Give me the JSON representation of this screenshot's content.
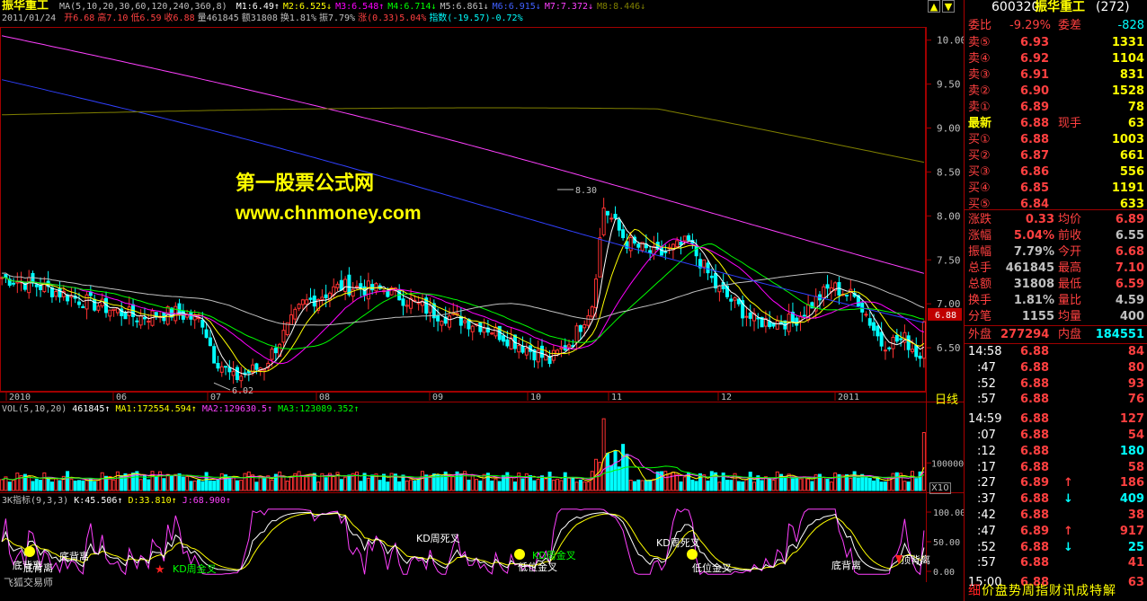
{
  "header": {
    "stock_name": "振华重工",
    "ma_line": "MA(5,10,20,30,60,120,240,360,8)",
    "ma_values": [
      {
        "label": "M1:6.49",
        "arrow": "↑",
        "color": "#ffffff"
      },
      {
        "label": "M2:6.525",
        "arrow": "↓",
        "color": "#ffff00"
      },
      {
        "label": "M3:6.548",
        "arrow": "↑",
        "color": "#ff00ff"
      },
      {
        "label": "M4:6.714",
        "arrow": "↓",
        "color": "#00ff00"
      },
      {
        "label": "M5:6.861",
        "arrow": "↓",
        "color": "#c0c0c0"
      },
      {
        "label": "M6:6.915",
        "arrow": "↓",
        "color": "#4060ff"
      },
      {
        "label": "M7:7.372",
        "arrow": "↓",
        "color": "#ff40ff"
      },
      {
        "label": "M8:8.446",
        "arrow": "↓",
        "color": "#808000"
      }
    ],
    "info_date": "2011/01/24",
    "info_items": [
      {
        "text": "开6.68",
        "color": "#ff4040"
      },
      {
        "text": "高7.10",
        "color": "#ff4040"
      },
      {
        "text": "低6.59",
        "color": "#ff4040"
      },
      {
        "text": "收6.88",
        "color": "#ff4040"
      },
      {
        "text": "量461845",
        "color": "#c0c0c0"
      },
      {
        "text": "额31808",
        "color": "#c0c0c0"
      },
      {
        "text": "换1.81%",
        "color": "#c0c0c0"
      },
      {
        "text": "振7.79%",
        "color": "#c0c0c0"
      },
      {
        "text": "涨(0.33)5.04%",
        "color": "#ff4040"
      },
      {
        "text": "指数(-19.57)-0.72%",
        "color": "#00ffff"
      }
    ]
  },
  "watermark": {
    "line1": "第一股票公式网",
    "line2": "www.chnmoney.com"
  },
  "main_chart": {
    "y_ticks": [
      "10.00",
      "9.50",
      "9.00",
      "8.50",
      "8.00",
      "7.50",
      "7.00",
      "6.50"
    ],
    "y_values": [
      10.0,
      9.5,
      9.0,
      8.5,
      8.0,
      7.5,
      7.0,
      6.5
    ],
    "x_labels": [
      "2010",
      "06",
      "07",
      "08",
      "09",
      "10",
      "11",
      "12",
      "2011"
    ],
    "x_positions": [
      0.005,
      0.12,
      0.222,
      0.34,
      0.462,
      0.568,
      0.655,
      0.774,
      0.9
    ],
    "period": "日线",
    "high_label": "8.30",
    "low_label": "6.02",
    "last_price_tag": "6.88"
  },
  "volume": {
    "title": "VOL(5,10,20)",
    "value": "461845",
    "ma1": "MA1:172554.594",
    "ma2": "MA2:129630.5",
    "ma3": "MA3:123089.352",
    "y_tick": "100000",
    "unit": "X10"
  },
  "kdj": {
    "title": "3K指标(9,3,3)",
    "k": "K:45.506",
    "d": "D:33.810",
    "j": "J:68.900",
    "y_ticks": [
      "100.00",
      "50.00",
      "0.00"
    ],
    "signals": [
      "底背离",
      "底背离",
      "KD周金叉",
      "KD周死叉",
      "KD周金叉",
      "KD周死叉",
      "低位金叉",
      "底背离",
      "顶背离",
      "低位金叉",
      "底背离"
    ],
    "footer": "飞狐交易师"
  },
  "right_panel": {
    "code": "600320",
    "name": "振华重工",
    "count": "(272)",
    "wei_bi_label": "委比",
    "wei_bi": "-9.29%",
    "wei_cha_label": "委差",
    "wei_cha": "-828",
    "asks": [
      {
        "label": "卖⑤",
        "price": "6.93",
        "vol": "1331"
      },
      {
        "label": "卖④",
        "price": "6.92",
        "vol": "1104"
      },
      {
        "label": "卖③",
        "price": "6.91",
        "vol": "831"
      },
      {
        "label": "卖②",
        "price": "6.90",
        "vol": "1528"
      },
      {
        "label": "卖①",
        "price": "6.89",
        "vol": "78"
      }
    ],
    "latest_label": "最新",
    "latest": "6.88",
    "now_hand_label": "现手",
    "now_hand": "63",
    "bids": [
      {
        "label": "买①",
        "price": "6.88",
        "vol": "1003"
      },
      {
        "label": "买②",
        "price": "6.87",
        "vol": "661"
      },
      {
        "label": "买③",
        "price": "6.86",
        "vol": "556"
      },
      {
        "label": "买④",
        "price": "6.85",
        "vol": "1191"
      },
      {
        "label": "买⑤",
        "price": "6.84",
        "vol": "633"
      }
    ],
    "stats": [
      {
        "l1": "涨跌",
        "v1": "0.33",
        "c1": "#ff4040",
        "l2": "均价",
        "v2": "6.89",
        "c2": "#ff4040"
      },
      {
        "l1": "涨幅",
        "v1": "5.04%",
        "c1": "#ff4040",
        "l2": "前收",
        "v2": "6.55",
        "c2": "#c0c0c0"
      },
      {
        "l1": "振幅",
        "v1": "7.79%",
        "c1": "#c0c0c0",
        "l2": "今开",
        "v2": "6.68",
        "c2": "#ff4040"
      },
      {
        "l1": "总手",
        "v1": "461845",
        "c1": "#c0c0c0",
        "l2": "最高",
        "v2": "7.10",
        "c2": "#ff4040"
      },
      {
        "l1": "总额",
        "v1": "31808",
        "c1": "#c0c0c0",
        "l2": "最低",
        "v2": "6.59",
        "c2": "#ff4040"
      },
      {
        "l1": "换手",
        "v1": "1.81%",
        "c1": "#c0c0c0",
        "l2": "量比",
        "v2": "4.59",
        "c2": "#c0c0c0"
      },
      {
        "l1": "分笔",
        "v1": "1155",
        "c1": "#c0c0c0",
        "l2": "均量",
        "v2": "400",
        "c2": "#c0c0c0"
      }
    ],
    "outer_label": "外盘",
    "outer": "277294",
    "inner_label": "内盘",
    "inner": "184551",
    "ticks": [
      {
        "t": "14:58",
        "p": "6.88",
        "v": "84",
        "pc": "#ff4040",
        "vc": "#ff4040",
        "a": ""
      },
      {
        "t": ":47",
        "p": "6.88",
        "v": "80",
        "pc": "#ff4040",
        "vc": "#ff4040",
        "a": ""
      },
      {
        "t": ":52",
        "p": "6.88",
        "v": "93",
        "pc": "#ff4040",
        "vc": "#ff4040",
        "a": ""
      },
      {
        "t": ":57",
        "p": "6.88",
        "v": "76",
        "pc": "#ff4040",
        "vc": "#ff4040",
        "a": ""
      },
      {
        "t": "14:59",
        "p": "6.88",
        "v": "127",
        "pc": "#ff4040",
        "vc": "#ff4040",
        "a": ""
      },
      {
        "t": ":07",
        "p": "6.88",
        "v": "54",
        "pc": "#ff4040",
        "vc": "#ff4040",
        "a": ""
      },
      {
        "t": ":12",
        "p": "6.88",
        "v": "180",
        "pc": "#ff4040",
        "vc": "#00ffff",
        "a": ""
      },
      {
        "t": ":17",
        "p": "6.88",
        "v": "58",
        "pc": "#ff4040",
        "vc": "#ff4040",
        "a": ""
      },
      {
        "t": ":27",
        "p": "6.89",
        "v": "186",
        "pc": "#ff4040",
        "vc": "#ff4040",
        "a": "up"
      },
      {
        "t": ":37",
        "p": "6.88",
        "v": "409",
        "pc": "#ff4040",
        "vc": "#00ffff",
        "a": "down"
      },
      {
        "t": ":42",
        "p": "6.88",
        "v": "38",
        "pc": "#ff4040",
        "vc": "#ff4040",
        "a": ""
      },
      {
        "t": ":47",
        "p": "6.89",
        "v": "917",
        "pc": "#ff4040",
        "vc": "#ff4040",
        "a": "up"
      },
      {
        "t": ":52",
        "p": "6.88",
        "v": "25",
        "pc": "#ff4040",
        "vc": "#00ffff",
        "a": "down"
      },
      {
        "t": ":57",
        "p": "6.88",
        "v": "41",
        "pc": "#ff4040",
        "vc": "#ff4040",
        "a": ""
      },
      {
        "t": "15:00",
        "p": "6.88",
        "v": "63",
        "pc": "#ff4040",
        "vc": "#ff4040",
        "a": ""
      }
    ],
    "tabs": [
      "细",
      "价",
      "盘",
      "势",
      "周",
      "指",
      "财",
      "讯",
      "成",
      "特",
      "解"
    ]
  }
}
